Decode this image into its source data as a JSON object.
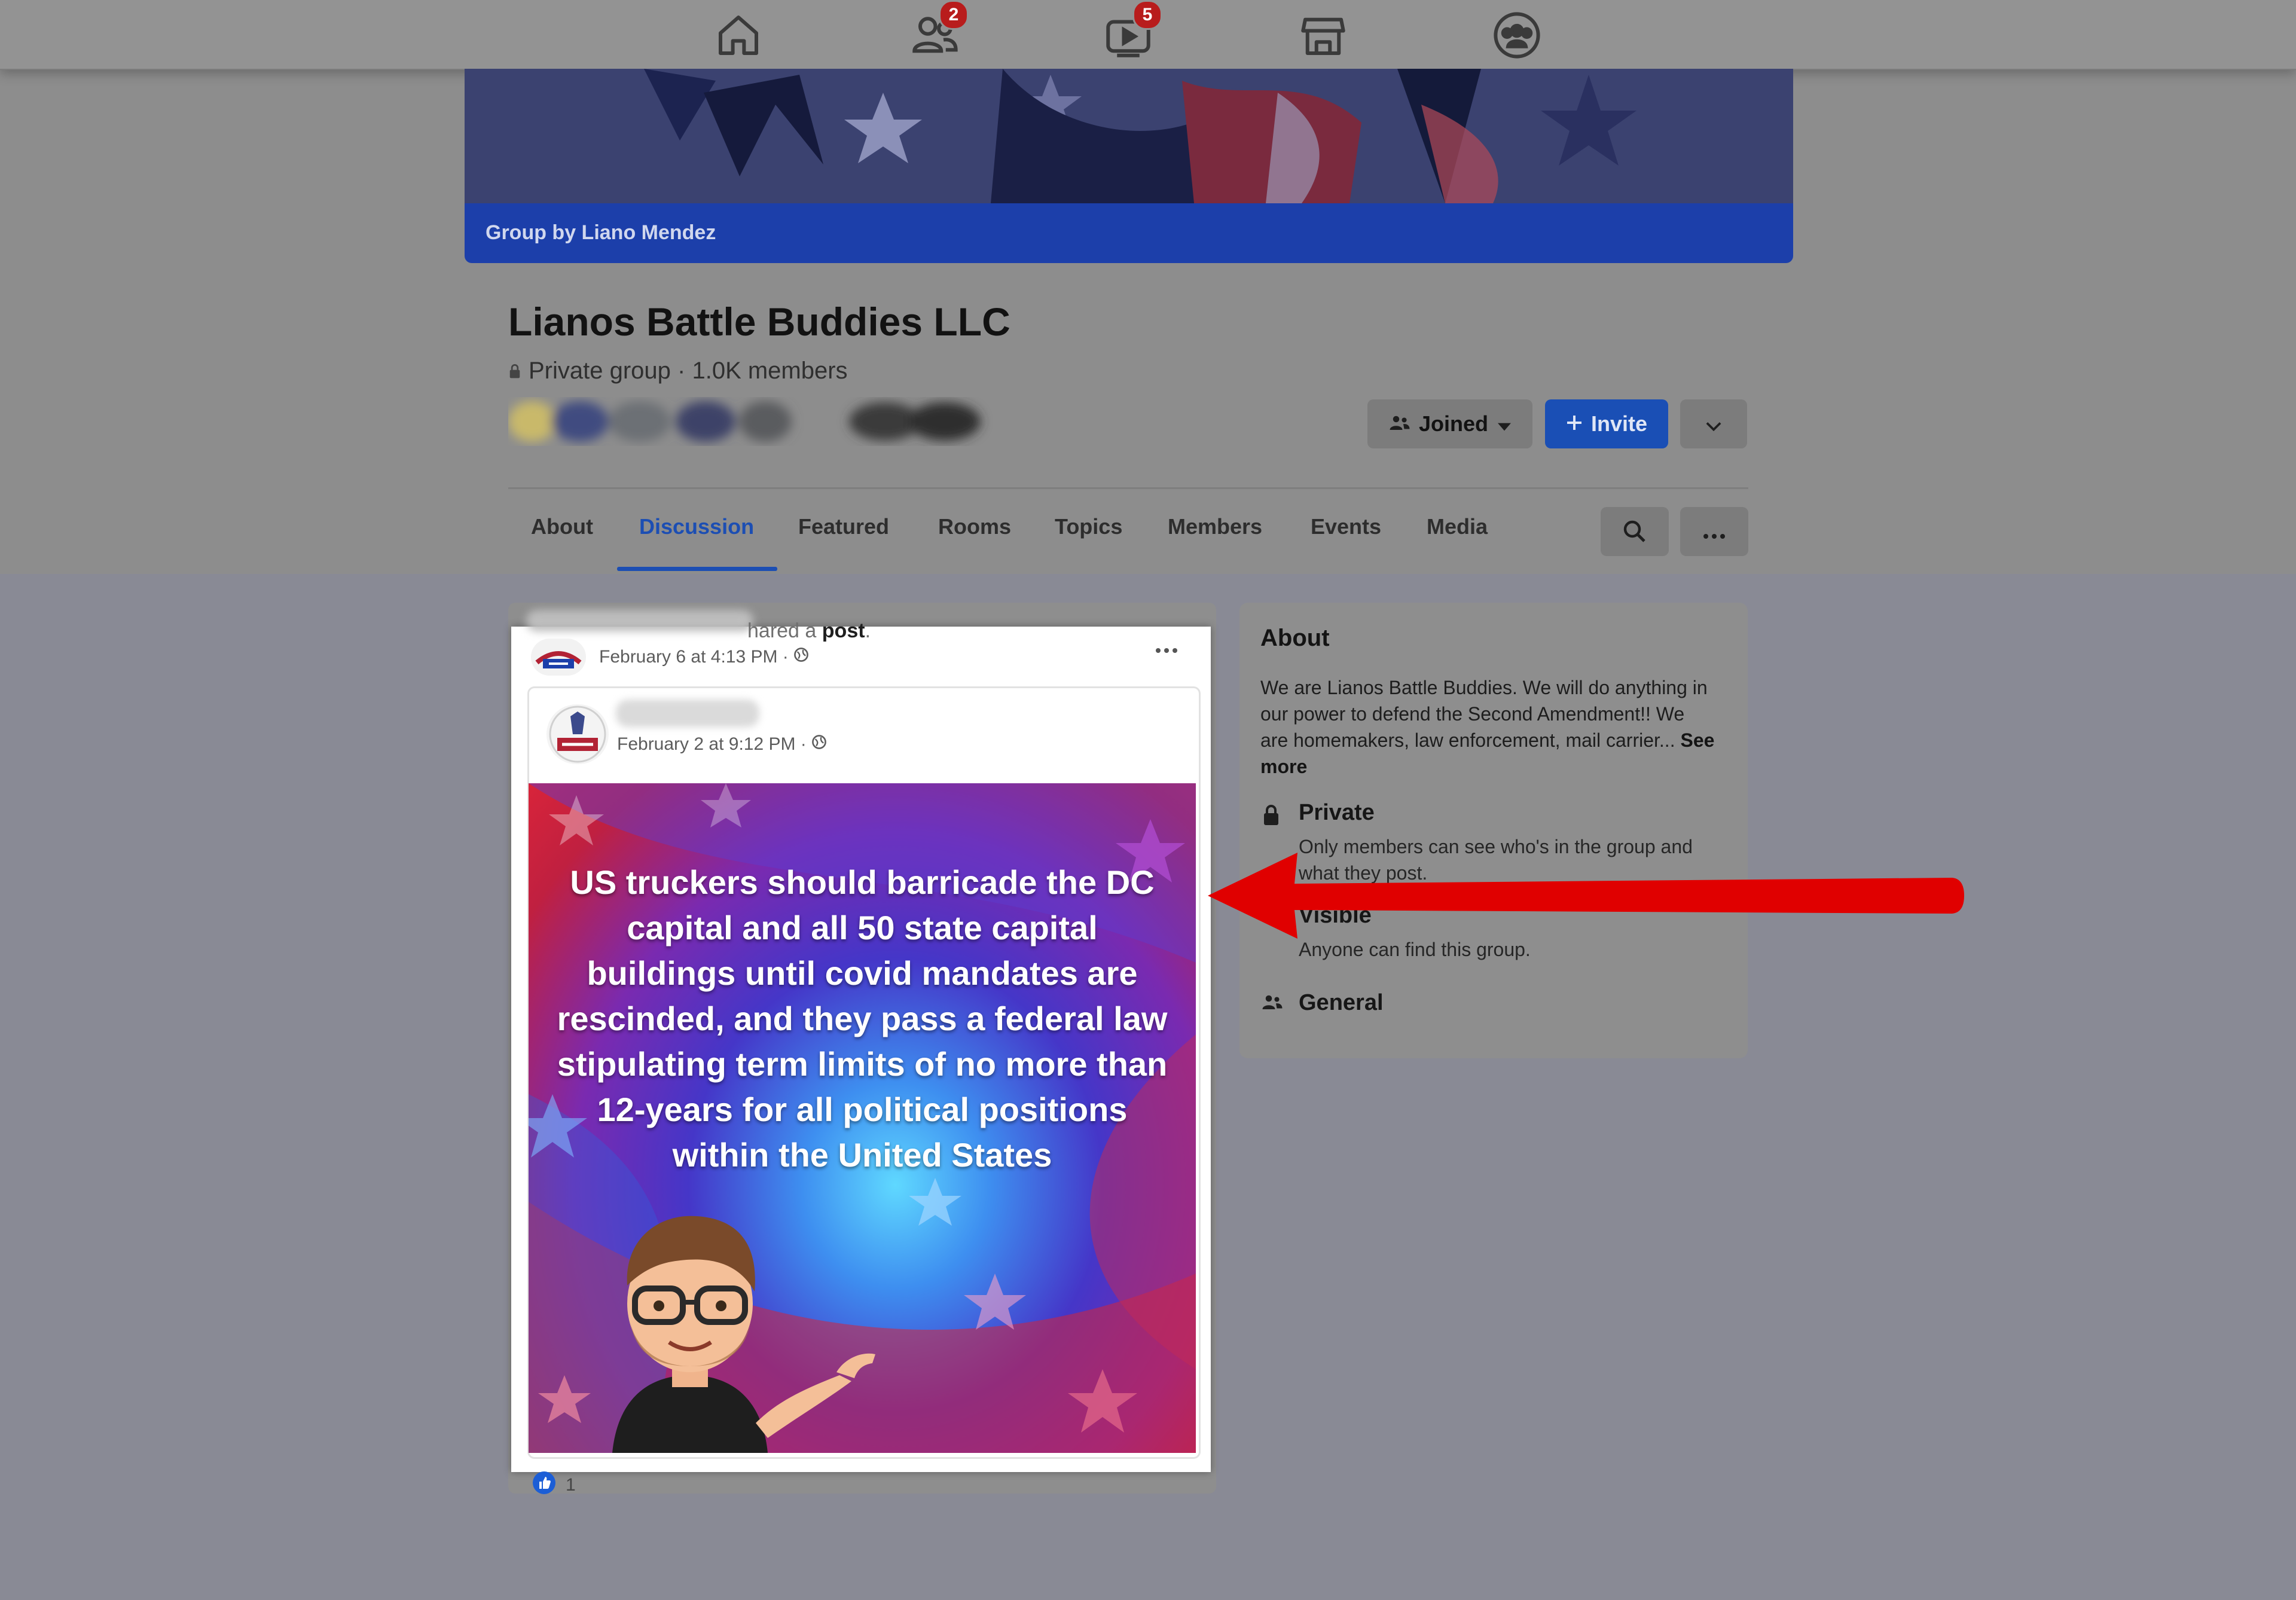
{
  "nav": {
    "icons": [
      "home-icon",
      "friends-icon",
      "watch-icon",
      "marketplace-icon",
      "groups-icon"
    ],
    "friends_badge": "2",
    "watch_badge": "5"
  },
  "cover": {
    "caption": "Group by Liano Mendez",
    "strip_color": "#1c3faa"
  },
  "group": {
    "title": "Lianos Battle Buddies LLC",
    "meta": "Private group · 1.0K members"
  },
  "actions": {
    "joined_label": "Joined",
    "invite_label": "Invite",
    "invite_color": "#1a4fb5"
  },
  "tabs": [
    {
      "label": "About"
    },
    {
      "label": "Discussion",
      "active": true
    },
    {
      "label": "Featured"
    },
    {
      "label": "Rooms"
    },
    {
      "label": "Topics"
    },
    {
      "label": "Members"
    },
    {
      "label": "Events"
    },
    {
      "label": "Media"
    }
  ],
  "post": {
    "shared_prefix": "hared a",
    "shared_bold": "post",
    "shared_suffix": ".",
    "time": "February 6 at 4:13 PM ·",
    "inner_time": "February 2 at 9:12 PM ·",
    "meme_text": "US truckers should barricade the DC capital and all 50 state capital buildings until covid mandates are rescinded, and they pass a federal law stipulating term limits of no more than 12-years for all political positions within the United States",
    "reaction_count": "1"
  },
  "about": {
    "title": "About",
    "description": "We are Lianos Battle Buddies. We will do anything in our power to defend the Second Amendment!! We are homemakers, law enforcement, mail carrier...",
    "see_more": "See more",
    "private_label": "Private",
    "private_sub": "Only members can see who's in the group and what they post.",
    "visible_label": "Visible",
    "visible_sub": "Anyone can find this group.",
    "general_label": "General"
  },
  "annotation": {
    "arrow_color": "#e00000"
  }
}
